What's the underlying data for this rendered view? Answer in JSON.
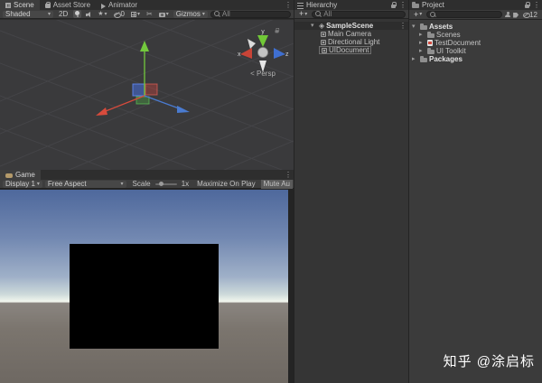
{
  "icons": {
    "kebab": "⋮",
    "dropdown_arrow": "▾",
    "collapsed_triangle": "▸",
    "expanded_triangle": "▾",
    "plus": "+",
    "scissors": "✂",
    "effects_star": "★",
    "scene_asset": "◈"
  },
  "colors": {
    "axis_x_red": "#d84b3c",
    "axis_y_green": "#73c93d",
    "axis_z_blue": "#4a7bd0",
    "sky_top": "#4e689c",
    "sky_horizon": "#eef4ec",
    "ground": "#746e67",
    "panel_bg": "#3d3d3d",
    "view_bg": "#3a3a3c"
  },
  "scene_panel": {
    "tabs": [
      "Scene",
      "Asset Store",
      "Animator"
    ],
    "toolbar": {
      "draw_mode": "Shaded",
      "mode_2d": "2D",
      "hidden_count": "0",
      "gizmos": "Gizmos",
      "search_value": "All"
    },
    "gizmo": {
      "x": "x",
      "y": "y",
      "z": "z",
      "projection": "< Persp"
    }
  },
  "game_panel": {
    "tab": "Game",
    "toolbar": {
      "display": "Display 1",
      "aspect": "Free Aspect",
      "scale_label": "Scale",
      "scale_value": "1x",
      "maximize": "Maximize On Play",
      "mute": "Mute Au"
    }
  },
  "hierarchy": {
    "title": "Hierarchy",
    "search_value": "All",
    "scene_root": "SampleScene",
    "items": [
      "Main Camera",
      "Directional Light",
      "UIDocument"
    ]
  },
  "project": {
    "title": "Project",
    "hidden_count": "12",
    "root": "Assets",
    "children": [
      "Scenes",
      "TestDocument",
      "UI Toolkit"
    ],
    "packages": "Packages"
  },
  "watermark": "知乎 @涂启标"
}
